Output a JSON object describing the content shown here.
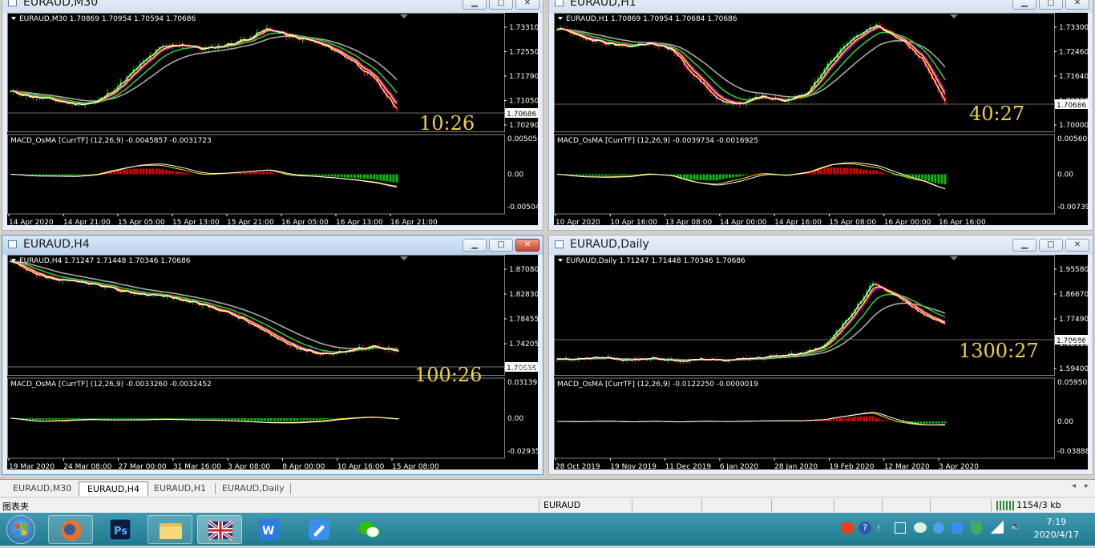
{
  "windows": {
    "m30": {
      "title": "EURAUD,M30",
      "info": "EURAUD,M30  1.70869 1.70954 1.70594 1.70686",
      "prices": [
        "1.73310",
        "1.72550",
        "1.71790",
        "1.71050",
        "1.70290"
      ],
      "current_price": "1.70686",
      "timer": "10:26",
      "macd_label": "MACD_OsMA [CurrTF] (12,26,9) -0.0045857 -0.0031723",
      "macd_levels": [
        "0.005058",
        "0.00",
        "-0.005044"
      ],
      "time_labels": [
        "14 Apr 2020",
        "14 Apr 21:00",
        "15 Apr 05:00",
        "15 Apr 13:00",
        "15 Apr 21:00",
        "16 Apr 05:00",
        "16 Apr 13:00",
        "16 Apr 21:00"
      ]
    },
    "h1": {
      "title": "EURAUD,H1",
      "info": "EURAUD,H1  1.70869 1.70954 1.70684 1.70686",
      "prices": [
        "1.73300",
        "1.72460",
        "1.71640",
        "1.70820",
        "1.70000"
      ],
      "current_price": "1.70686",
      "timer": "40:27",
      "macd_label": "MACD_OsMA [CurrTF] (12,26,9) -0.0039734 -0.0016925",
      "macd_levels": [
        "0.0056056",
        "0.00",
        "-0.007390"
      ],
      "time_labels": [
        "10 Apr 2020",
        "10 Apr 16:00",
        "13 Apr 08:00",
        "14 Apr 00:00",
        "14 Apr 16:00",
        "15 Apr 08:00",
        "16 Apr 00:00",
        "16 Apr 16:00"
      ]
    },
    "h4": {
      "title": "EURAUD,H4",
      "info": "EURAUD,H4  1.71247 1.71448 1.70346 1.70686",
      "prices": [
        "1.87080",
        "1.82830",
        "1.78455",
        "1.74205",
        "1.69955"
      ],
      "current_price": "1.70686",
      "timer": "100:26",
      "macd_label": "MACD_OsMA [CurrTF] (12,26,9) -0.0033260 -0.0032452",
      "macd_levels": [
        "0.0313937",
        "0.00",
        "-0.029351"
      ],
      "time_labels": [
        "19 Mar 2020",
        "24 Mar 08:00",
        "27 Mar 00:00",
        "31 Mar 16:00",
        "3 Apr 08:00",
        "8 Apr 00:00",
        "10 Apr 16:00",
        "15 Apr 08:00"
      ]
    },
    "daily": {
      "title": "EURAUD,Daily",
      "info": "EURAUD,Daily  1.71247 1.71448 1.70346 1.70686",
      "prices": [
        "1.95580",
        "1.86670",
        "1.77490",
        "1.68310",
        "1.59400"
      ],
      "current_price": "1.70686",
      "timer": "1300:27",
      "macd_label": "MACD_OsMA [CurrTF] (12,26,9) -0.0122250 -0.0000019",
      "macd_levels": [
        "0.0595034",
        "0.00",
        "-0.038889"
      ],
      "time_labels": [
        "28 Oct 2019",
        "19 Nov 2019",
        "11 Dec 2019",
        "6 Jan 2020",
        "28 Jan 2020",
        "19 Feb 2020",
        "12 Mar 2020",
        "3 Apr 2020"
      ]
    }
  },
  "tabs": [
    "EURAUD,M30",
    "EURAUD,H4",
    "EURAUD,H1",
    "EURAUD,Daily"
  ],
  "active_tab": "EURAUD,H4",
  "status": {
    "left": "图表夹",
    "symbol": "EURAUD",
    "traffic": "1154/3 kb"
  },
  "clock": {
    "time": "7:19",
    "date": "2020/4/17"
  },
  "colors": {
    "bull": "#00c000",
    "bear": "#e00000",
    "ma_fast": "#ffffff",
    "ma_yellow": "#ffe000",
    "ma_magenta": "#ff00ff",
    "ma_green": "#32c832",
    "ma_gray": "#a8a8a8",
    "timer": "#f0d040"
  },
  "taskbar_icons": [
    "start-orb",
    "firefox",
    "photoshop",
    "file-explorer",
    "flag-uk",
    "wps-writer",
    "feishu",
    "wechat"
  ]
}
